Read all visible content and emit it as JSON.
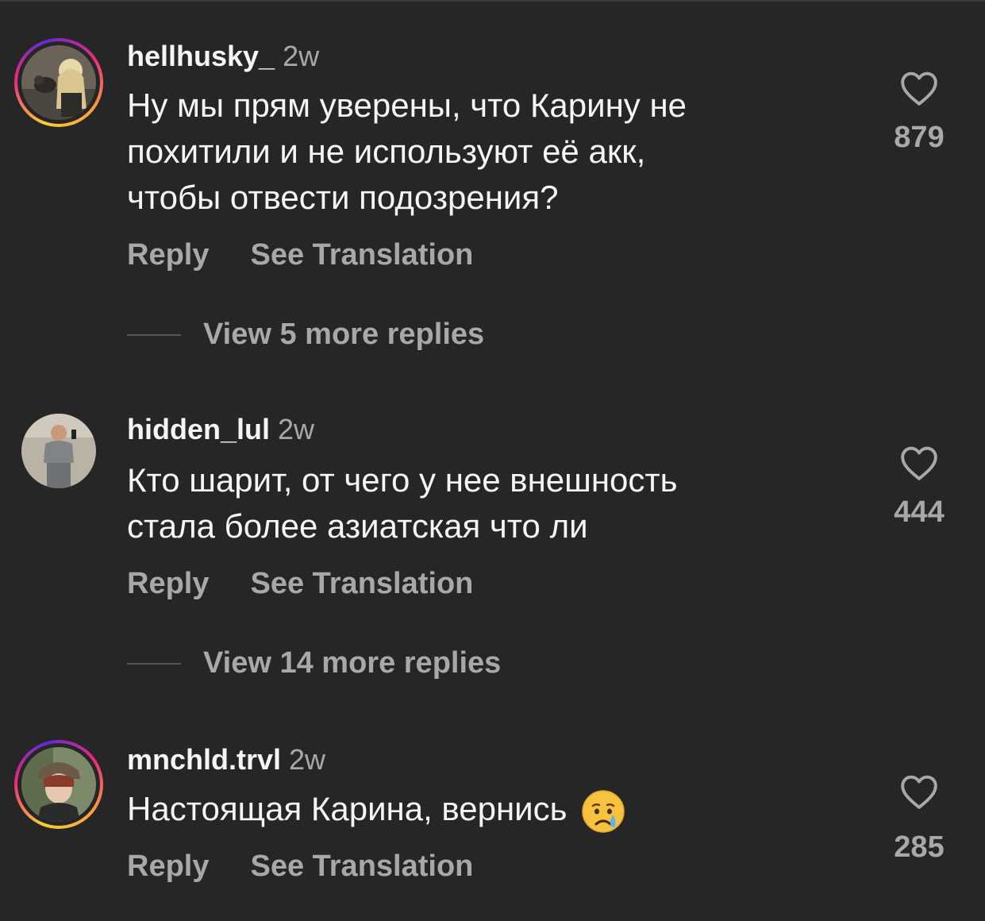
{
  "comments": [
    {
      "username": "hellhusky_",
      "time": "2w",
      "text_lines": [
        "Ну мы прям уверены, что Карину не",
        "похитили и не используют её акк,",
        "чтобы отвести подозрения?"
      ],
      "reply_label": "Reply",
      "translate_label": "See Translation",
      "likes": "879",
      "view_replies": "View 5 more replies",
      "story_ring": true
    },
    {
      "username": "hidden_lul",
      "time": "2w",
      "text_lines": [
        "Кто шарит, от чего у нее внешность",
        "стала более азиатская что ли"
      ],
      "reply_label": "Reply",
      "translate_label": "See Translation",
      "likes": "444",
      "view_replies": "View 14 more replies",
      "story_ring": false
    },
    {
      "username": "mnchld.trvl",
      "time": "2w",
      "text_lines": [
        "Настоящая Карина, вернись"
      ],
      "emoji": "crying-face-emoji",
      "reply_label": "Reply",
      "translate_label": "See Translation",
      "likes": "285",
      "story_ring": true
    }
  ],
  "colors": {
    "background": "#262626",
    "primary_text": "#f5f5f5",
    "secondary_text": "#a8a8a8"
  }
}
